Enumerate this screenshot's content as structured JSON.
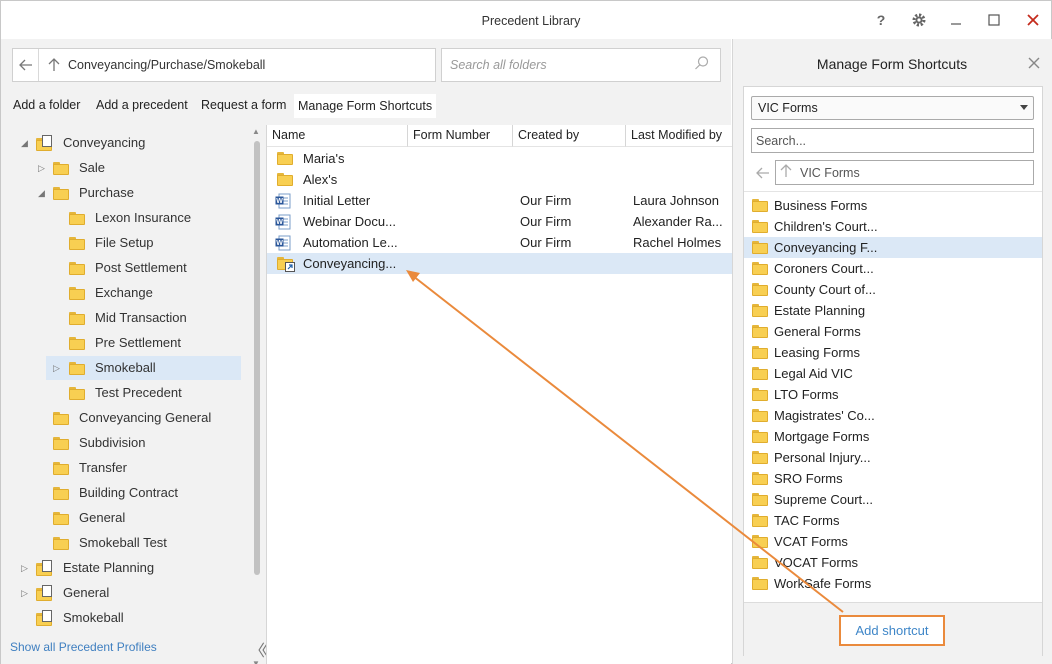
{
  "window": {
    "title": "Precedent Library",
    "controls": [
      "help-icon",
      "gear-icon",
      "minimize-icon",
      "maximize-icon",
      "close-icon"
    ],
    "close_color": "#c42b1c"
  },
  "nav": {
    "path": "Conveyancing/Purchase/Smokeball",
    "search_placeholder": "Search all folders"
  },
  "toolbar": {
    "add_folder": "Add a folder",
    "add_precedent": "Add a precedent",
    "request_form": "Request a form",
    "manage_shortcuts": "Manage Form Shortcuts"
  },
  "tree": {
    "items": [
      {
        "label": "Conveyancing",
        "expanded": true
      },
      {
        "label": "Sale"
      },
      {
        "label": "Purchase",
        "expanded": true
      },
      {
        "label": "Lexon Insurance"
      },
      {
        "label": "File Setup"
      },
      {
        "label": "Post Settlement"
      },
      {
        "label": "Exchange"
      },
      {
        "label": "Mid Transaction"
      },
      {
        "label": "Pre Settlement"
      },
      {
        "label": "Smokeball",
        "selected": true
      },
      {
        "label": "Test Precedent"
      },
      {
        "label": "Conveyancing General"
      },
      {
        "label": "Subdivision"
      },
      {
        "label": "Transfer"
      },
      {
        "label": "Building Contract"
      },
      {
        "label": "General"
      },
      {
        "label": "Smokeball Test"
      },
      {
        "label": "Estate Planning"
      },
      {
        "label": "General"
      },
      {
        "label": "Smokeball"
      }
    ],
    "show_profiles": "Show all Precedent Profiles",
    "selection_color": "#dbe8f6"
  },
  "files": {
    "columns": [
      "Name",
      "Form Number",
      "Created by",
      "Last Modified by"
    ],
    "rows": [
      {
        "name": "Maria's",
        "form_number": "",
        "created_by": "",
        "modified_by": "",
        "icon": "folder-icon"
      },
      {
        "name": "Alex's",
        "form_number": "",
        "created_by": "",
        "modified_by": "",
        "icon": "folder-icon"
      },
      {
        "name": "Initial Letter",
        "form_number": "",
        "created_by": "Our Firm",
        "modified_by": "Laura Johnson",
        "icon": "word-document-icon"
      },
      {
        "name": "Webinar Docu...",
        "form_number": "",
        "created_by": "Our Firm",
        "modified_by": "Alexander Ra...",
        "icon": "word-document-icon"
      },
      {
        "name": "Automation Le...",
        "form_number": "",
        "created_by": "Our Firm",
        "modified_by": "Rachel Holmes",
        "icon": "word-document-icon"
      },
      {
        "name": "Conveyancing...",
        "form_number": "",
        "created_by": "",
        "modified_by": "",
        "icon": "folder-shortcut-icon",
        "selected": true
      }
    ]
  },
  "shortcuts_panel": {
    "title": "Manage Form Shortcuts",
    "dropdown_value": "VIC Forms",
    "search_placeholder": "Search...",
    "path": "VIC Forms",
    "folders": [
      "Business Forms",
      "Children's Court...",
      "Conveyancing F...",
      "Coroners Court...",
      "County Court of...",
      "Estate Planning",
      "General Forms",
      "Leasing Forms",
      "Legal Aid VIC",
      "LTO Forms",
      "Magistrates' Co...",
      "Mortgage Forms",
      "Personal Injury...",
      "SRO Forms",
      "Supreme Court...",
      "TAC Forms",
      "VCAT Forms",
      "VOCAT Forms",
      "WorkSafe Forms"
    ],
    "selected_index": 2,
    "add_shortcut": "Add shortcut",
    "highlight_color": "#ea8a3c",
    "link_color": "#3e86c8"
  }
}
